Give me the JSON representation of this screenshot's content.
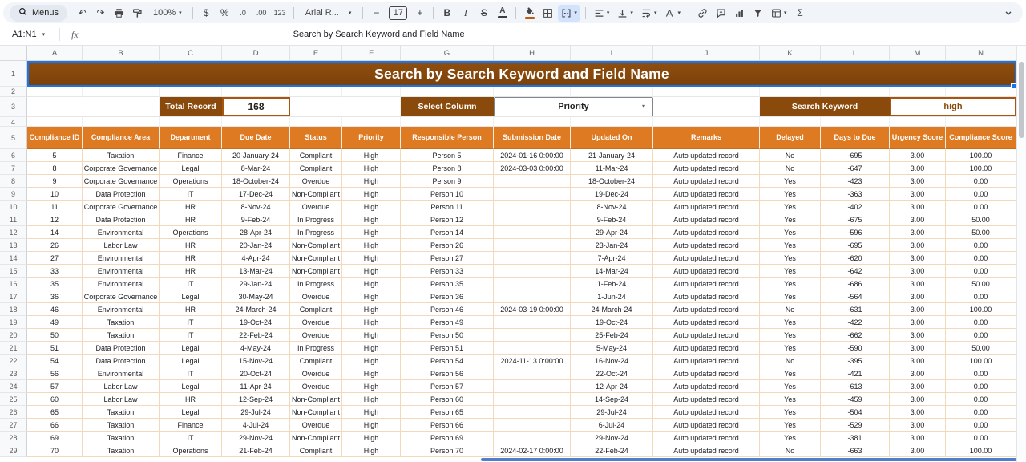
{
  "icons": {
    "chevron_down": "▾"
  },
  "toolbar": {
    "menus_label": "Menus",
    "undo": "↶",
    "redo": "↷",
    "zoom": "100%",
    "currency": "$",
    "percent": "%",
    "decrease_decimal": ".0",
    "increase_decimal": ".00",
    "more_formats": "123",
    "font_name": "Arial R...",
    "decrease_font": "−",
    "font_size": "17",
    "increase_font": "+",
    "bold": "B",
    "italic": "I",
    "strikethrough": "S",
    "text_color": "A",
    "functions": "Σ"
  },
  "formula_bar": {
    "cell_reference": "A1:N1",
    "fx_label": "fx",
    "content": "Search by Search Keyword and Field Name"
  },
  "sheet": {
    "title": "Search by Search Keyword and Field Name",
    "column_letters": [
      "A",
      "B",
      "C",
      "D",
      "E",
      "F",
      "G",
      "H",
      "I",
      "J",
      "K",
      "L",
      "M",
      "N"
    ],
    "row_numbers": [
      1,
      2,
      3,
      4,
      5,
      6,
      7,
      8,
      9,
      10,
      11,
      12,
      13,
      14,
      15,
      16,
      17,
      18,
      19,
      20,
      21,
      22,
      23,
      24,
      25,
      26,
      27,
      28,
      29
    ],
    "controls": {
      "total_record_label": "Total Record",
      "total_record_value": "168",
      "select_column_label": "Select Column",
      "select_column_value": "Priority",
      "search_keyword_label": "Search Keyword",
      "search_keyword_value": "high"
    },
    "table": {
      "headers": [
        "Compliance ID",
        "Compliance Area",
        "Department",
        "Due Date",
        "Status",
        "Priority",
        "Responsible Person",
        "Submission Date",
        "Updated On",
        "Remarks",
        "Delayed",
        "Days to Due",
        "Urgency Score",
        "Compliance Score"
      ],
      "rows": [
        [
          "5",
          "Taxation",
          "Finance",
          "20-January-24",
          "Compliant",
          "High",
          "Person 5",
          "2024-01-16 0:00:00",
          "21-January-24",
          "Auto updated record",
          "No",
          "-695",
          "3.00",
          "100.00"
        ],
        [
          "8",
          "Corporate Governance",
          "Legal",
          "8-Mar-24",
          "Compliant",
          "High",
          "Person 8",
          "2024-03-03 0:00:00",
          "11-Mar-24",
          "Auto updated record",
          "No",
          "-647",
          "3.00",
          "100.00"
        ],
        [
          "9",
          "Corporate Governance",
          "Operations",
          "18-October-24",
          "Overdue",
          "High",
          "Person 9",
          "",
          "18-October-24",
          "Auto updated record",
          "Yes",
          "-423",
          "3.00",
          "0.00"
        ],
        [
          "10",
          "Data Protection",
          "IT",
          "17-Dec-24",
          "Non-Compliant",
          "High",
          "Person 10",
          "",
          "19-Dec-24",
          "Auto updated record",
          "Yes",
          "-363",
          "3.00",
          "0.00"
        ],
        [
          "11",
          "Corporate Governance",
          "HR",
          "8-Nov-24",
          "Overdue",
          "High",
          "Person 11",
          "",
          "8-Nov-24",
          "Auto updated record",
          "Yes",
          "-402",
          "3.00",
          "0.00"
        ],
        [
          "12",
          "Data Protection",
          "HR",
          "9-Feb-24",
          "In Progress",
          "High",
          "Person 12",
          "",
          "9-Feb-24",
          "Auto updated record",
          "Yes",
          "-675",
          "3.00",
          "50.00"
        ],
        [
          "14",
          "Environmental",
          "Operations",
          "28-Apr-24",
          "In Progress",
          "High",
          "Person 14",
          "",
          "29-Apr-24",
          "Auto updated record",
          "Yes",
          "-596",
          "3.00",
          "50.00"
        ],
        [
          "26",
          "Labor Law",
          "HR",
          "20-Jan-24",
          "Non-Compliant",
          "High",
          "Person 26",
          "",
          "23-Jan-24",
          "Auto updated record",
          "Yes",
          "-695",
          "3.00",
          "0.00"
        ],
        [
          "27",
          "Environmental",
          "HR",
          "4-Apr-24",
          "Non-Compliant",
          "High",
          "Person 27",
          "",
          "7-Apr-24",
          "Auto updated record",
          "Yes",
          "-620",
          "3.00",
          "0.00"
        ],
        [
          "33",
          "Environmental",
          "HR",
          "13-Mar-24",
          "Non-Compliant",
          "High",
          "Person 33",
          "",
          "14-Mar-24",
          "Auto updated record",
          "Yes",
          "-642",
          "3.00",
          "0.00"
        ],
        [
          "35",
          "Environmental",
          "IT",
          "29-Jan-24",
          "In Progress",
          "High",
          "Person 35",
          "",
          "1-Feb-24",
          "Auto updated record",
          "Yes",
          "-686",
          "3.00",
          "50.00"
        ],
        [
          "36",
          "Corporate Governance",
          "Legal",
          "30-May-24",
          "Overdue",
          "High",
          "Person 36",
          "",
          "1-Jun-24",
          "Auto updated record",
          "Yes",
          "-564",
          "3.00",
          "0.00"
        ],
        [
          "46",
          "Environmental",
          "HR",
          "24-March-24",
          "Compliant",
          "High",
          "Person 46",
          "2024-03-19 0:00:00",
          "24-March-24",
          "Auto updated record",
          "No",
          "-631",
          "3.00",
          "100.00"
        ],
        [
          "49",
          "Taxation",
          "IT",
          "19-Oct-24",
          "Overdue",
          "High",
          "Person 49",
          "",
          "19-Oct-24",
          "Auto updated record",
          "Yes",
          "-422",
          "3.00",
          "0.00"
        ],
        [
          "50",
          "Taxation",
          "IT",
          "22-Feb-24",
          "Overdue",
          "High",
          "Person 50",
          "",
          "25-Feb-24",
          "Auto updated record",
          "Yes",
          "-662",
          "3.00",
          "0.00"
        ],
        [
          "51",
          "Data Protection",
          "Legal",
          "4-May-24",
          "In Progress",
          "High",
          "Person 51",
          "",
          "5-May-24",
          "Auto updated record",
          "Yes",
          "-590",
          "3.00",
          "50.00"
        ],
        [
          "54",
          "Data Protection",
          "Legal",
          "15-Nov-24",
          "Compliant",
          "High",
          "Person 54",
          "2024-11-13 0:00:00",
          "16-Nov-24",
          "Auto updated record",
          "No",
          "-395",
          "3.00",
          "100.00"
        ],
        [
          "56",
          "Environmental",
          "IT",
          "20-Oct-24",
          "Overdue",
          "High",
          "Person 56",
          "",
          "22-Oct-24",
          "Auto updated record",
          "Yes",
          "-421",
          "3.00",
          "0.00"
        ],
        [
          "57",
          "Labor Law",
          "Legal",
          "11-Apr-24",
          "Overdue",
          "High",
          "Person 57",
          "",
          "12-Apr-24",
          "Auto updated record",
          "Yes",
          "-613",
          "3.00",
          "0.00"
        ],
        [
          "60",
          "Labor Law",
          "HR",
          "12-Sep-24",
          "Non-Compliant",
          "High",
          "Person 60",
          "",
          "14-Sep-24",
          "Auto updated record",
          "Yes",
          "-459",
          "3.00",
          "0.00"
        ],
        [
          "65",
          "Taxation",
          "Legal",
          "29-Jul-24",
          "Non-Compliant",
          "High",
          "Person 65",
          "",
          "29-Jul-24",
          "Auto updated record",
          "Yes",
          "-504",
          "3.00",
          "0.00"
        ],
        [
          "66",
          "Taxation",
          "Finance",
          "4-Jul-24",
          "Overdue",
          "High",
          "Person 66",
          "",
          "6-Jul-24",
          "Auto updated record",
          "Yes",
          "-529",
          "3.00",
          "0.00"
        ],
        [
          "69",
          "Taxation",
          "IT",
          "29-Nov-24",
          "Non-Compliant",
          "High",
          "Person 69",
          "",
          "29-Nov-24",
          "Auto updated record",
          "Yes",
          "-381",
          "3.00",
          "0.00"
        ],
        [
          "70",
          "Taxation",
          "Operations",
          "21-Feb-24",
          "Compliant",
          "High",
          "Person 70",
          "2024-02-17 0:00:00",
          "22-Feb-24",
          "Auto updated record",
          "No",
          "-663",
          "3.00",
          "100.00"
        ]
      ]
    }
  },
  "colors": {
    "title_bg": "#8a4a0c",
    "table_header_bg": "#dd7a22",
    "control_label_bg": "#8a4a0c",
    "grid_line": "#f3d9bb",
    "selection_blue": "#1a73e8",
    "fill_color_swatch": "#bf5b0e",
    "merge_active_bg": "#d3e3fd"
  }
}
